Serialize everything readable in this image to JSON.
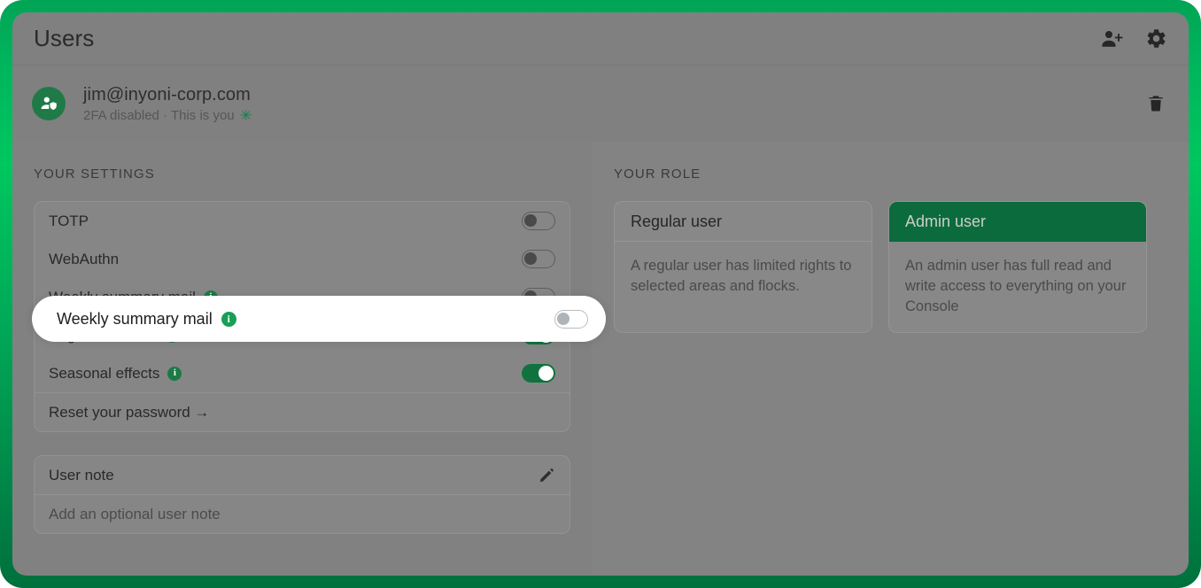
{
  "header": {
    "title": "Users",
    "actions": [
      {
        "name": "add-user-button",
        "icon": "user-plus-icon"
      },
      {
        "name": "settings-button",
        "icon": "gear-icon"
      }
    ]
  },
  "user": {
    "avatar_icon": "user-shield-icon",
    "email": "jim@inyoni-corp.com",
    "subtitle": "2FA disabled · This is you",
    "you_marker": "✳",
    "delete_label": "delete-user",
    "delete_icon": "trash-icon"
  },
  "settings": {
    "section_label": "YOUR SETTINGS",
    "rows": [
      {
        "label": "TOTP",
        "has_info": false,
        "toggle": "off"
      },
      {
        "label": "WebAuthn",
        "has_info": false,
        "toggle": "off"
      },
      {
        "label": "Weekly summary mail",
        "has_info": true,
        "toggle": "off"
      },
      {
        "label": "Page transitions",
        "has_info": true,
        "toggle": "on"
      },
      {
        "label": "Seasonal effects",
        "has_info": true,
        "toggle": "on"
      }
    ],
    "reset_password_label": "Reset your password →"
  },
  "note": {
    "title": "User note",
    "edit_icon": "pencil-icon",
    "placeholder": "Add an optional user note"
  },
  "role": {
    "section_label": "YOUR ROLE",
    "cards": [
      {
        "title": "Regular user",
        "description": "A regular user has limited rights to selected areas and flocks.",
        "selected": false
      },
      {
        "title": "Admin user",
        "description": "An admin user has full read and write access to everything on your Console",
        "selected": true
      }
    ]
  },
  "spotlight": {
    "label": "Weekly summary mail",
    "has_info": true,
    "toggle": "off"
  },
  "colors": {
    "frame_green_top": "#00C75F",
    "frame_green_bottom": "#00703C",
    "accent_green": "#1C7A46",
    "selected_role_green": "#0C6B3C",
    "toggle_on_green": "#10733F",
    "surface": "#808080"
  }
}
